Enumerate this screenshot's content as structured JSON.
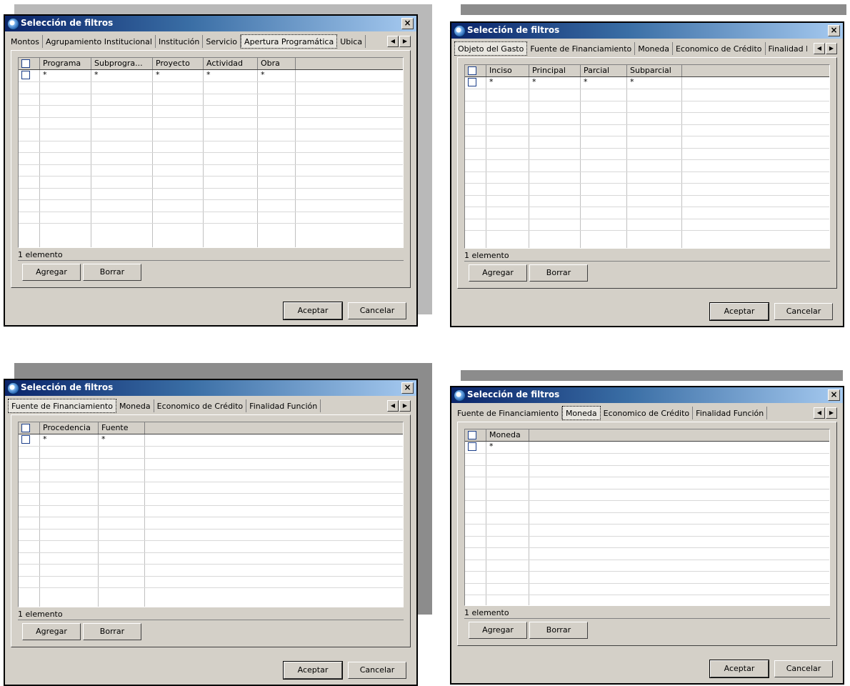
{
  "dialogs": [
    {
      "title": "Selección de filtros",
      "tabs": [
        "Montos",
        "Agrupamiento Institucional",
        "Institución",
        "Servicio",
        "Apertura Programática",
        "Ubica"
      ],
      "active_tab": 4,
      "columns": [
        "Programa",
        "Subprogra...",
        "Proyecto",
        "Actividad",
        "Obra"
      ],
      "row_values": [
        "*",
        "*",
        "*",
        "*",
        "*"
      ],
      "status": "1 elemento",
      "buttons": {
        "add": "Agregar",
        "delete": "Borrar",
        "accept": "Aceptar",
        "cancel": "Cancelar"
      }
    },
    {
      "title": "Selección de filtros",
      "tabs": [
        "Objeto del Gasto",
        "Fuente de Financiamiento",
        "Moneda",
        "Economico de Crédito",
        "Finalidad F"
      ],
      "active_tab": 0,
      "columns": [
        "Inciso",
        "Principal",
        "Parcial",
        "Subparcial"
      ],
      "row_values": [
        "*",
        "*",
        "*",
        "*"
      ],
      "status": "1 elemento",
      "buttons": {
        "add": "Agregar",
        "delete": "Borrar",
        "accept": "Aceptar",
        "cancel": "Cancelar"
      }
    },
    {
      "title": "Selección de filtros",
      "tabs": [
        "Fuente de Financiamiento",
        "Moneda",
        "Economico de Crédito",
        "Finalidad Función"
      ],
      "active_tab": 0,
      "columns": [
        "Procedencia",
        "Fuente"
      ],
      "row_values": [
        "*",
        "*"
      ],
      "status": "1 elemento",
      "buttons": {
        "add": "Agregar",
        "delete": "Borrar",
        "accept": "Aceptar",
        "cancel": "Cancelar"
      }
    },
    {
      "title": "Selección de filtros",
      "tabs": [
        "Fuente de Financiamiento",
        "Moneda",
        "Economico de Crédito",
        "Finalidad Función"
      ],
      "active_tab": 1,
      "columns": [
        "Moneda"
      ],
      "row_values": [
        "*"
      ],
      "status": "1 elemento",
      "buttons": {
        "add": "Agregar",
        "delete": "Borrar",
        "accept": "Aceptar",
        "cancel": "Cancelar"
      }
    }
  ],
  "icons": {
    "title": "app-globe-icon",
    "close": "close-icon",
    "tab_left": "arrow-left-icon",
    "tab_right": "arrow-right-icon"
  },
  "colors": {
    "titlebar_start": "#0a246a",
    "titlebar_end": "#a6caf0",
    "dialog_bg": "#d4d0c8"
  }
}
